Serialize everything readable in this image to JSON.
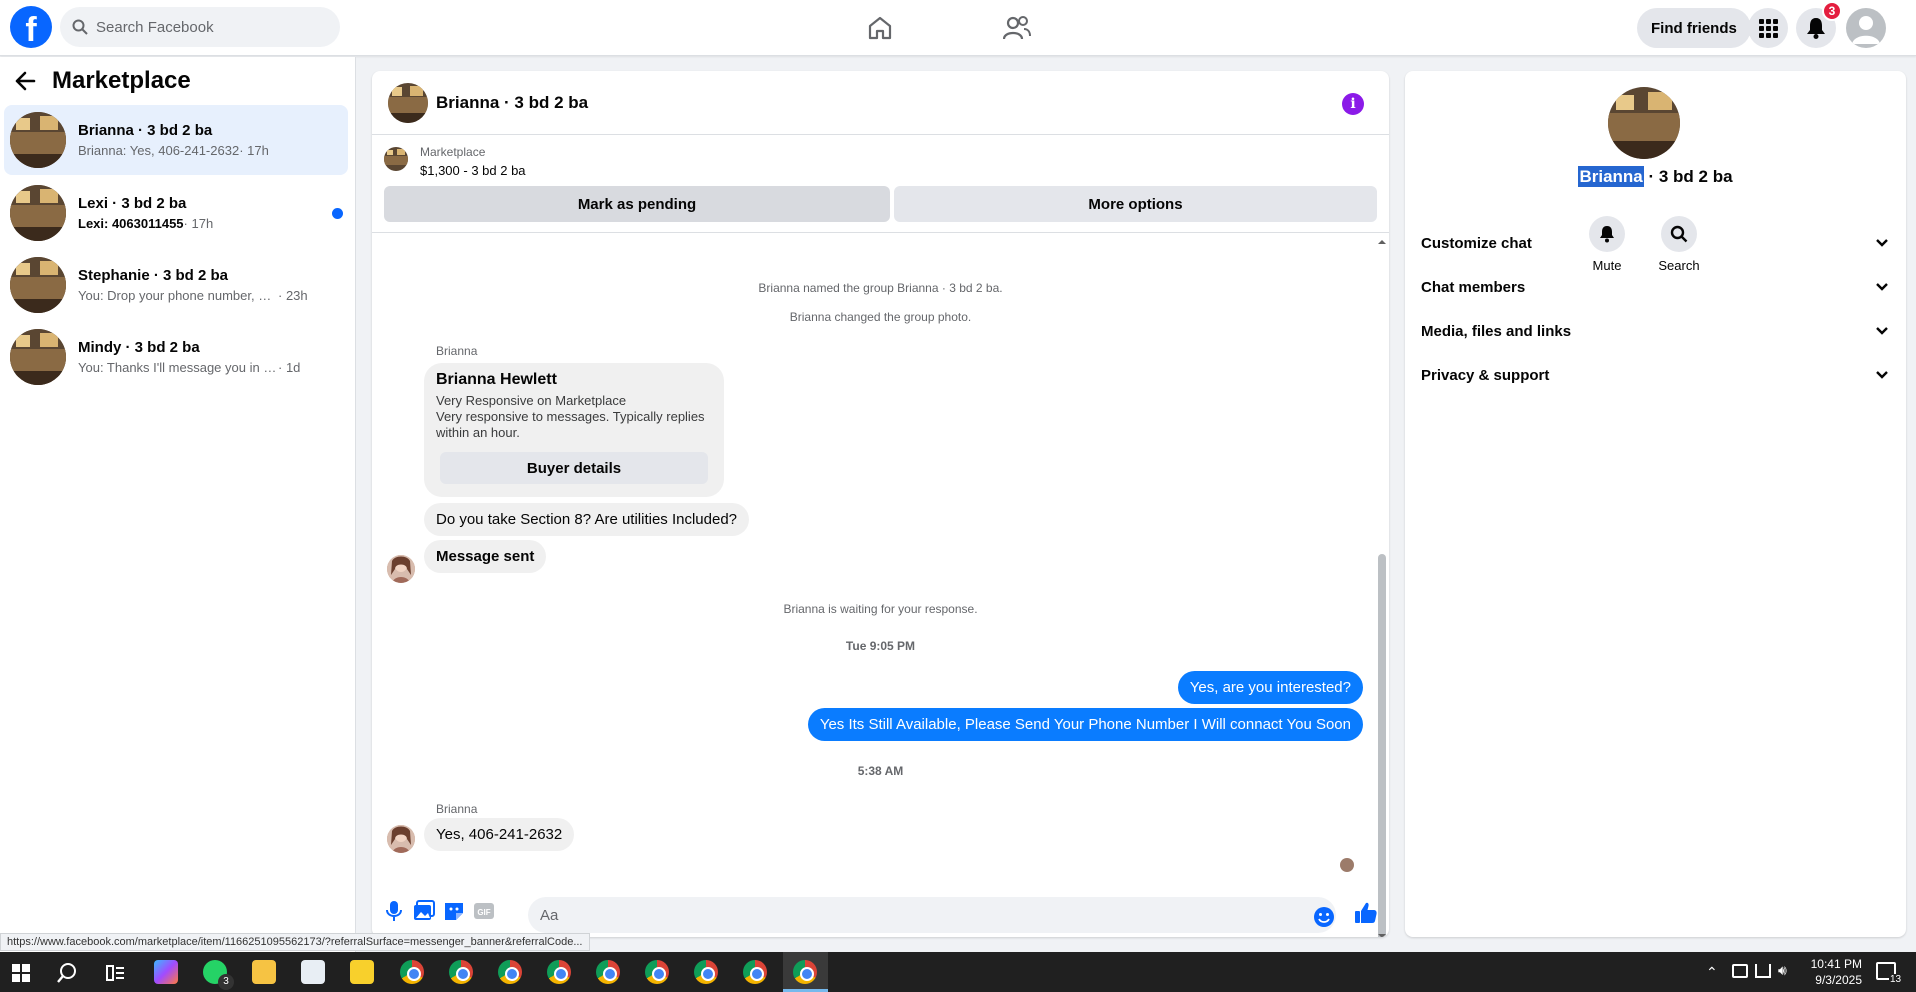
{
  "topbar": {
    "search_placeholder": "Search Facebook",
    "find_friends": "Find friends",
    "notif_count": "3"
  },
  "sidebar": {
    "title": "Marketplace",
    "conversations": [
      {
        "name": "Brianna · 3 bd 2 ba",
        "snippet": "Brianna: Yes, 406-241-2632",
        "time": "· 17h"
      },
      {
        "name": "Lexi · 3 bd 2 ba",
        "snippet": "Lexi: 4063011455",
        "time": "· 17h"
      },
      {
        "name": "Stephanie · 3 bd 2 ba",
        "snippet": "You: Drop your phone number, and ...",
        "time": "· 23h"
      },
      {
        "name": "Mindy · 3 bd 2 ba",
        "snippet": "You: Thanks I'll message you in a mo...",
        "time": "· 1d"
      }
    ]
  },
  "chat": {
    "title": "Brianna · 3 bd 2 ba",
    "marketplace_label": "Marketplace",
    "listing": "$1,300 - 3 bd 2 ba",
    "mark_pending": "Mark as pending",
    "more_options": "More options",
    "sys1": "Brianna named the group Brianna · 3 bd 2 ba.",
    "sys2": "Brianna changed the group photo.",
    "sender": "Brianna",
    "card_name": "Brianna Hewlett",
    "card_line1": "Very Responsive on Marketplace",
    "card_line2": "Very responsive to messages. Typically replies within an hour.",
    "card_button": "Buyer details",
    "msg_question": "Do you take Section 8? Are utilities Included?",
    "msg_sent": "Message sent",
    "waiting": "Brianna is waiting for your response.",
    "time1": "Tue 9:05 PM",
    "out1": "Yes, are you interested?",
    "out2": "Yes Its Still Available, Please Send Your Phone Number I Will connact You Soon",
    "time2": "5:38 AM",
    "sender2": "Brianna",
    "msg_last": "Yes, 406-241-2632",
    "composer_placeholder": "Aa"
  },
  "details": {
    "name_highlight": "Brianna",
    "name_rest": " · 3 bd 2 ba",
    "mute": "Mute",
    "search": "Search",
    "sections": [
      "Customize chat",
      "Chat members",
      "Media, files and links",
      "Privacy & support"
    ]
  },
  "statusbar": {
    "url": "https://www.facebook.com/marketplace/item/1166251095562173/?referralSurface=messenger_banner&referralCode..."
  },
  "taskbar": {
    "time": "10:41 PM",
    "date": "9/3/2025",
    "notif_count": "13",
    "whatsapp_count": "3"
  },
  "colors": {
    "brand": "#0866ff",
    "outgoing_bubble": "#0a7cff",
    "badge": "#e41e3f"
  }
}
